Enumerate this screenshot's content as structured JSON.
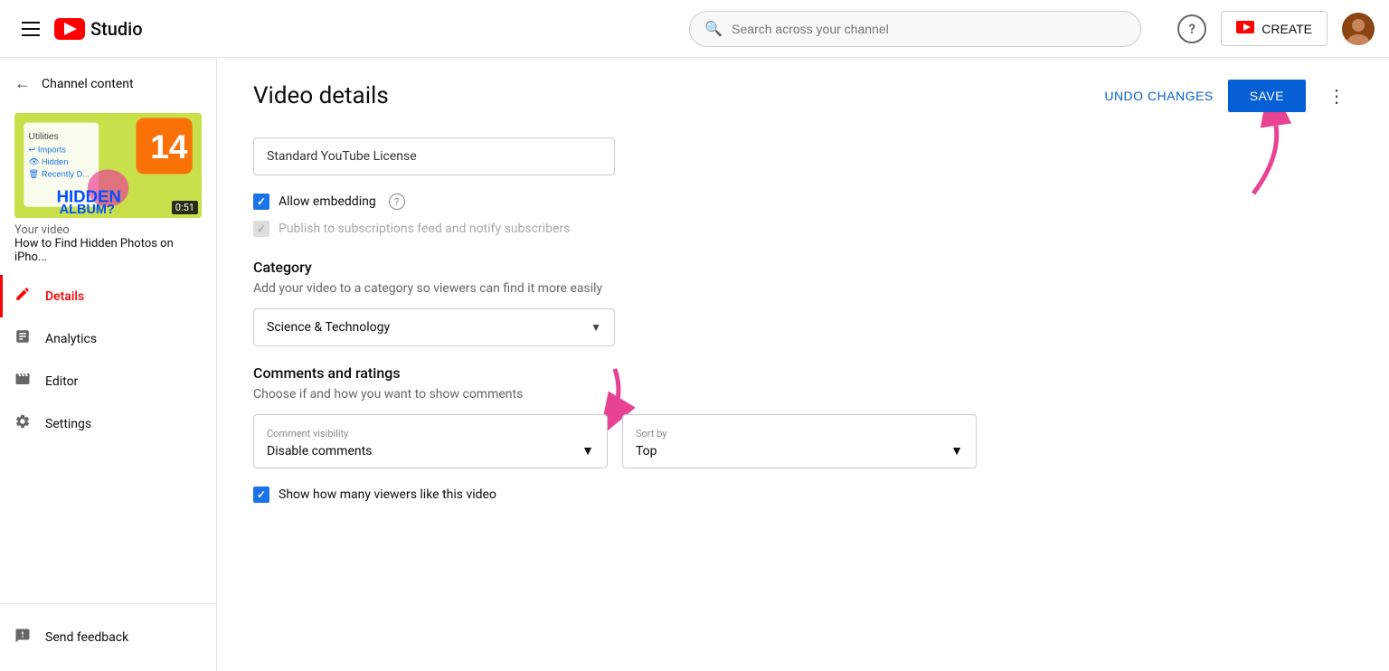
{
  "app": {
    "name": "Studio",
    "logo_alt": "YouTube Studio"
  },
  "nav": {
    "search_placeholder": "Search across your channel",
    "create_label": "CREATE",
    "help_label": "?"
  },
  "sidebar": {
    "back_label": "Channel content",
    "video": {
      "title_prefix": "Your video",
      "title": "How to Find Hidden Photos on iPho...",
      "duration": "0:51"
    },
    "items": [
      {
        "id": "details",
        "label": "Details",
        "icon": "✏️",
        "active": true
      },
      {
        "id": "analytics",
        "label": "Analytics",
        "icon": "📊",
        "active": false
      },
      {
        "id": "editor",
        "label": "Editor",
        "icon": "🎬",
        "active": false
      },
      {
        "id": "settings",
        "label": "Settings",
        "icon": "⚙️",
        "active": false
      }
    ],
    "bottom": {
      "send_feedback": "Send feedback"
    }
  },
  "page": {
    "title": "Video details",
    "undo_label": "UNDO CHANGES",
    "save_label": "SAVE"
  },
  "form": {
    "license_value": "Standard YouTube License",
    "allow_embedding_label": "Allow embedding",
    "publish_feed_label": "Publish to subscriptions feed and notify subscribers",
    "category_section_title": "Category",
    "category_section_desc": "Add your video to a category so viewers can find it more easily",
    "category_value": "Science & Technology",
    "comments_section_title": "Comments and ratings",
    "comments_section_desc": "Choose if and how you want to show comments",
    "comment_visibility_label": "Comment visibility",
    "comment_visibility_value": "Disable comments",
    "sort_by_label": "Sort by",
    "sort_by_value": "Top",
    "show_likes_label": "Show how many viewers like this video",
    "allow_embedding_checked": true,
    "publish_feed_checked": false,
    "show_likes_checked": true
  }
}
